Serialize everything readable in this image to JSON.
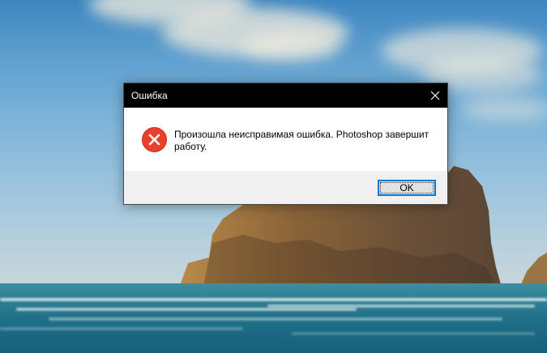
{
  "desktop": {
    "wallpaper": "beach-rock-wallpaper"
  },
  "dialog": {
    "title": "Ошибка",
    "message": "Произошла неисправимая ошибка. Photoshop завершит работу.",
    "icon": "error-icon",
    "close_icon": "close-icon",
    "ok_label": "OK",
    "colors": {
      "titlebar": "#000000",
      "error_icon": "#e8402a",
      "button_focus": "#0078d7",
      "footer": "#f0f0f0"
    }
  }
}
